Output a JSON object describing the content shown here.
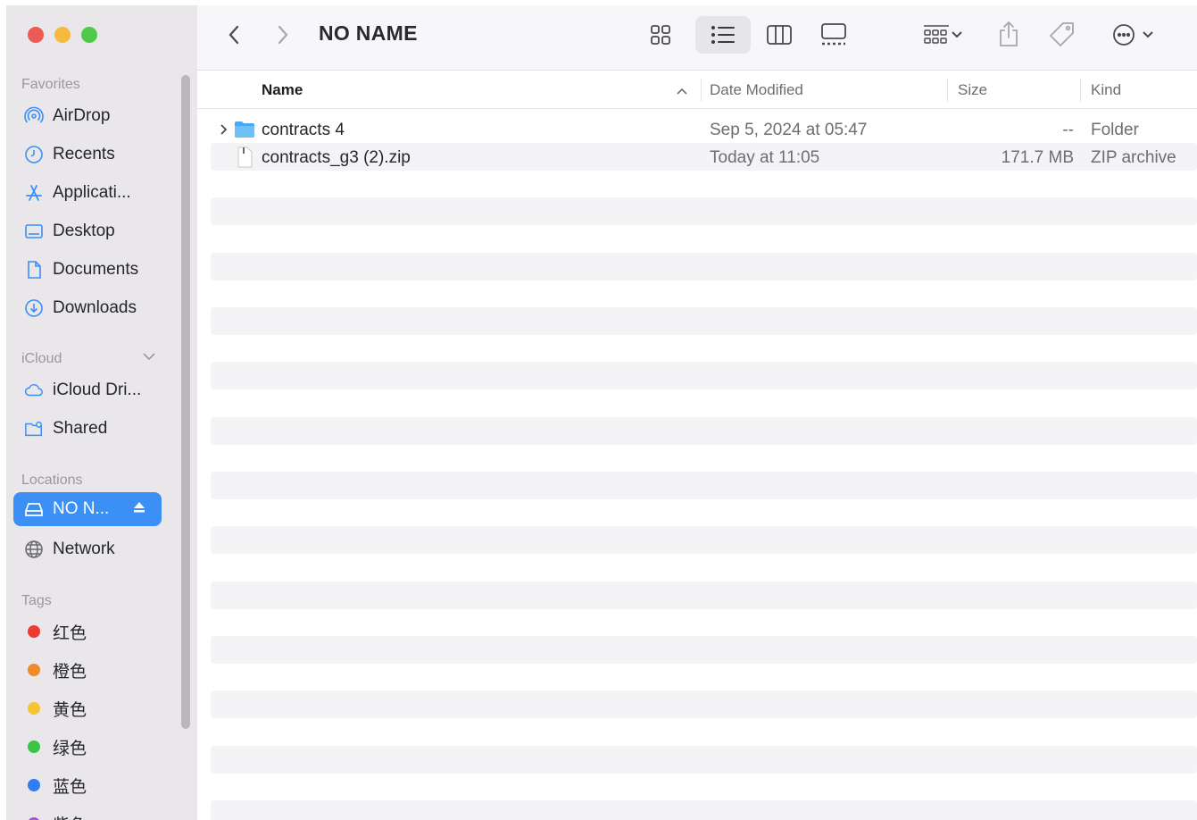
{
  "window": {
    "title": "NO NAME"
  },
  "colors": {
    "accent": "#3b8ff5",
    "sidebar_bg": "#e9e7ea",
    "folder_blue": "#5ab3f0"
  },
  "sidebar": {
    "favorites_label": "Favorites",
    "favorites": [
      {
        "label": "AirDrop",
        "icon": "airdrop-icon"
      },
      {
        "label": "Recents",
        "icon": "clock-icon"
      },
      {
        "label": "Applicati...",
        "icon": "applications-icon"
      },
      {
        "label": "Desktop",
        "icon": "desktop-icon"
      },
      {
        "label": "Documents",
        "icon": "document-icon"
      },
      {
        "label": "Downloads",
        "icon": "download-icon"
      }
    ],
    "icloud_label": "iCloud",
    "icloud": [
      {
        "label": "iCloud Dri...",
        "icon": "cloud-icon"
      },
      {
        "label": "Shared",
        "icon": "shared-folder-icon"
      }
    ],
    "locations_label": "Locations",
    "locations": [
      {
        "label": "NO N...",
        "icon": "drive-icon",
        "selected": true
      },
      {
        "label": "Network",
        "icon": "globe-icon"
      }
    ],
    "tags_label": "Tags",
    "tags": [
      {
        "label": "红色",
        "color": "#ee3a32"
      },
      {
        "label": "橙色",
        "color": "#f08a2c"
      },
      {
        "label": "黄色",
        "color": "#f5c431"
      },
      {
        "label": "绿色",
        "color": "#3bc544"
      },
      {
        "label": "蓝色",
        "color": "#2f7ef4"
      },
      {
        "label": "紫色",
        "color": "#a352d6"
      }
    ]
  },
  "columns": {
    "name": "Name",
    "date": "Date Modified",
    "size": "Size",
    "kind": "Kind"
  },
  "files": [
    {
      "name": "contracts 4",
      "date": "Sep 5, 2024 at 05:47",
      "size": "--",
      "kind": "Folder",
      "type": "folder",
      "expandable": true
    },
    {
      "name": "contracts_g3 (2).zip",
      "date": "Today at 11:05",
      "size": "171.7 MB",
      "kind": "ZIP archive",
      "type": "zip",
      "expandable": false
    }
  ]
}
